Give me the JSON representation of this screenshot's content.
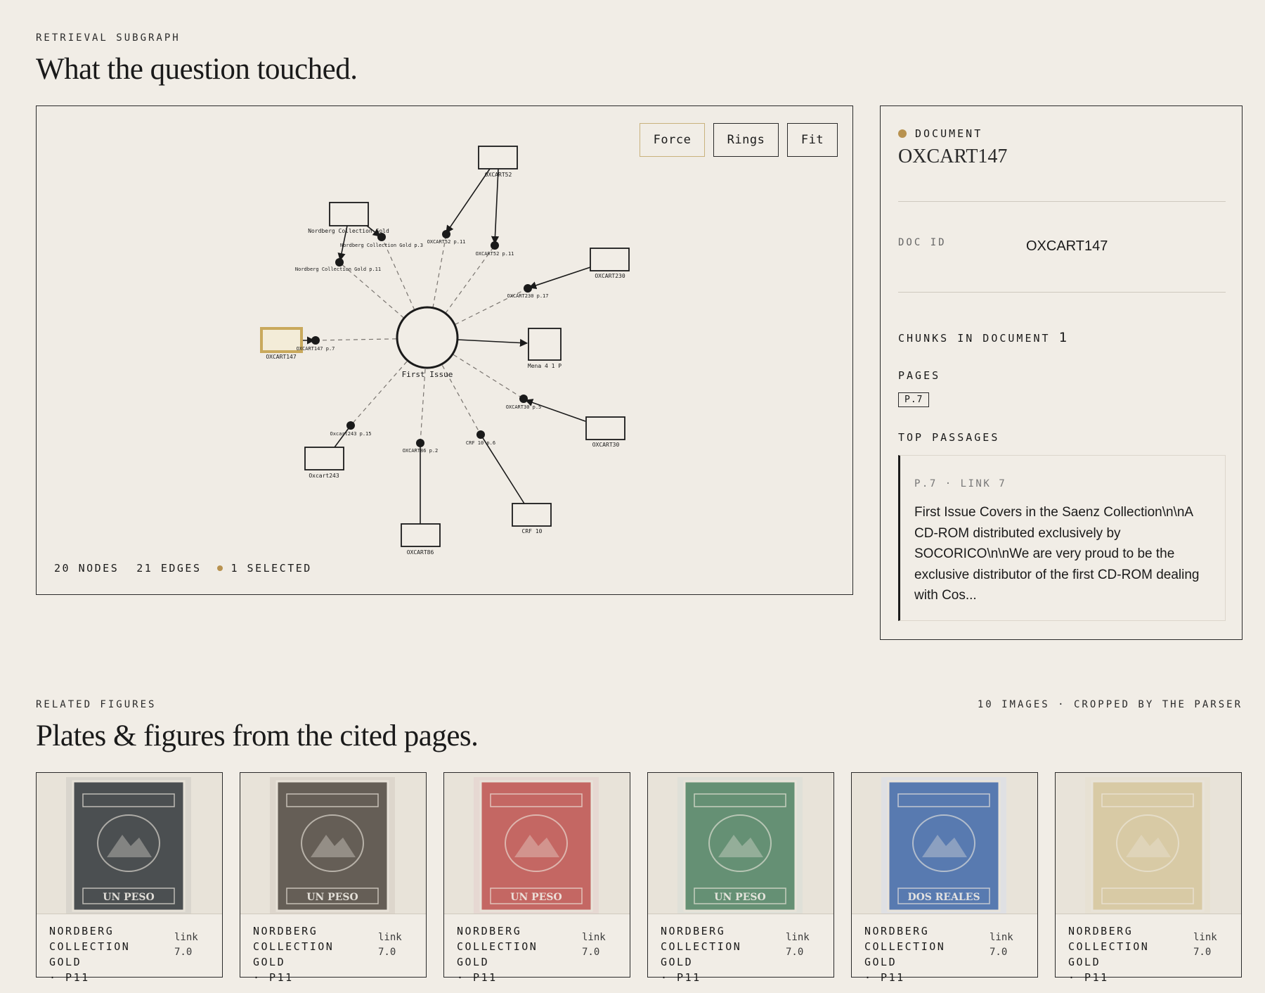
{
  "subgraph": {
    "eyebrow": "RETRIEVAL SUBGRAPH",
    "title": "What the question touched."
  },
  "toolbar": {
    "force_label": "Force",
    "rings_label": "Rings",
    "fit_label": "Fit"
  },
  "graph": {
    "nodes_count": "20 NODES",
    "edges_count": "21 EDGES",
    "selected_count": "1 SELECTED",
    "center_label": "First Issue",
    "doc_nodes": [
      {
        "id": "d1",
        "label": "OXCART52",
        "selected": false
      },
      {
        "id": "d2",
        "label": "Nordberg Collection Gold",
        "selected": false
      },
      {
        "id": "d3",
        "label": "OXCART230",
        "selected": false
      },
      {
        "id": "d4",
        "label": "OXCART147",
        "selected": true
      },
      {
        "id": "d5",
        "label": "Mena 4 1 P",
        "selected": false
      },
      {
        "id": "d6",
        "label": "OXCART30",
        "selected": false
      },
      {
        "id": "d7",
        "label": "Oxcart243",
        "selected": false
      },
      {
        "id": "d8",
        "label": "OXCART86",
        "selected": false
      },
      {
        "id": "d9",
        "label": "CRF 10",
        "selected": false
      }
    ],
    "chunk_nodes": [
      {
        "id": "c1",
        "label": "OXCART52 p.11",
        "doc": "d1"
      },
      {
        "id": "c2",
        "label": "OXCART52 p.11",
        "doc": "d1"
      },
      {
        "id": "c3",
        "label": "Nordberg Collection Gold p.3",
        "doc": "d2"
      },
      {
        "id": "c4",
        "label": "Nordberg Collection Gold p.11",
        "doc": "d2"
      },
      {
        "id": "c5",
        "label": "OXCART230 p.17",
        "doc": "d3"
      },
      {
        "id": "c6",
        "label": "OXCART147 p.7",
        "doc": "d4"
      },
      {
        "id": "c7",
        "label": "OXCART30 p.5",
        "doc": "d6"
      },
      {
        "id": "c8",
        "label": "Oxcart243 p.15",
        "doc": "d7"
      },
      {
        "id": "c9",
        "label": "OXCART86 p.2",
        "doc": "d8"
      },
      {
        "id": "c10",
        "label": "CRF 10 p.6",
        "doc": "d9"
      }
    ]
  },
  "detail": {
    "type_label": "DOCUMENT",
    "title": "OXCART147",
    "doc_id_label": "DOC ID",
    "doc_id_value": "OXCART147",
    "chunks_label": "CHUNKS IN DOCUMENT",
    "chunks_value": "1",
    "pages_label": "PAGES",
    "pages": [
      "P.7"
    ],
    "top_passages_label": "TOP PASSAGES",
    "passage": {
      "meta": "P.7 · LINK 7",
      "text": "First Issue Covers in the Saenz Collection\\n\\nA CD-ROM distributed exclusively by SOCORICO\\n\\nWe are very proud to be the exclusive distributor of the first CD-ROM dealing with Cos..."
    },
    "accent_color": "#b8924f"
  },
  "figures": {
    "eyebrow": "RELATED FIGURES",
    "title": "Plates & figures from the cited pages.",
    "count_note": "10 IMAGES · CROPPED BY THE PARSER",
    "items": [
      {
        "caption_1": "NORDBERG",
        "caption_2": "COLLECTION GOLD",
        "caption_3": "· P11",
        "meta_1": "link",
        "meta_2": "7.0",
        "color": "#3f4447",
        "paper": "#d9d5cd",
        "plate": "UN PESO"
      },
      {
        "caption_1": "NORDBERG",
        "caption_2": "COLLECTION GOLD",
        "caption_3": "· P11",
        "meta_1": "link",
        "meta_2": "7.0",
        "color": "#5b544c",
        "paper": "#ddd6cc",
        "plate": "UN PESO"
      },
      {
        "caption_1": "NORDBERG",
        "caption_2": "COLLECTION GOLD",
        "caption_3": "· P11",
        "meta_1": "link",
        "meta_2": "7.0",
        "color": "#c25e5a",
        "paper": "#e6d8d2",
        "plate": "UN PESO"
      },
      {
        "caption_1": "NORDBERG",
        "caption_2": "COLLECTION GOLD",
        "caption_3": "· P11",
        "meta_1": "link",
        "meta_2": "7.0",
        "color": "#5b8a6c",
        "paper": "#dfe0d8",
        "plate": "UN PESO"
      },
      {
        "caption_1": "NORDBERG",
        "caption_2": "COLLECTION GOLD",
        "caption_3": "· P11",
        "meta_1": "link",
        "meta_2": "7.0",
        "color": "#4d72ac",
        "paper": "#dfe0e3",
        "plate": "DOS REALES"
      },
      {
        "caption_1": "NORDBERG",
        "caption_2": "COLLECTION GOLD",
        "caption_3": "· P11",
        "meta_1": "link",
        "meta_2": "7.0",
        "color": "#d7c9a2",
        "paper": "#e7e1d3",
        "plate": ""
      }
    ]
  }
}
